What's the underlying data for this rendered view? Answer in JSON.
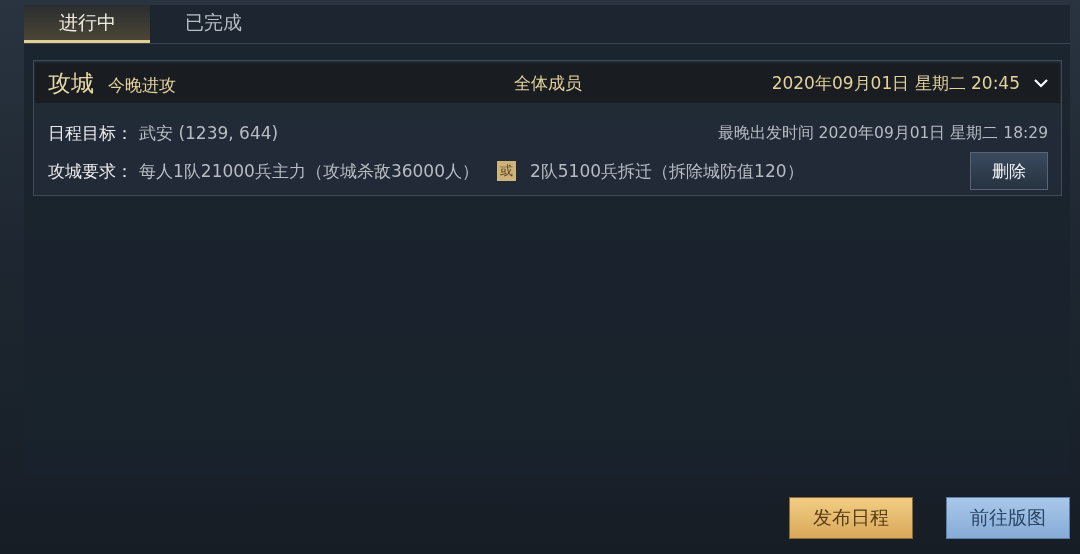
{
  "tabs": [
    {
      "label": "进行中",
      "selected": true
    },
    {
      "label": "已完成",
      "selected": false
    }
  ],
  "schedules": [
    {
      "title": "攻城",
      "subtitle": "今晚进攻",
      "audience": "全体成员",
      "datetime": "2020年09月01日 星期二 20:45",
      "expanded": true,
      "target_label": "日程目标：",
      "target_value": "武安 (1239, 644)",
      "deadline": "最晚出发时间 2020年09月01日 星期二 18:29",
      "requirement_label": "攻城要求：",
      "requirement_option_1": "每人1队21000兵主力（攻城杀敌36000人）",
      "or_badge": "或",
      "requirement_option_2": "2队5100兵拆迁（拆除城防值120）",
      "delete_button": "删除"
    }
  ],
  "buttons": [
    {
      "label": "发布日程",
      "kind": "gold"
    },
    {
      "label": "前往版图",
      "kind": "blue"
    }
  ]
}
